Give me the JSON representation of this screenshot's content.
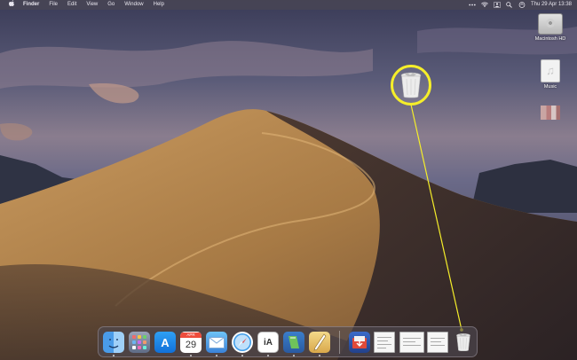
{
  "menubar": {
    "app_name": "Finder",
    "menus": [
      "File",
      "Edit",
      "View",
      "Go",
      "Window",
      "Help"
    ],
    "clock": "Thu 29 Apr  13:38"
  },
  "desktop": {
    "icons": [
      {
        "label": "Macintosh HD",
        "icon": "hard-drive-icon"
      },
      {
        "label": "Music",
        "icon": "music-file-icon"
      },
      {
        "label": "",
        "icon": "image-thumbnail-icon"
      }
    ]
  },
  "dock": {
    "calendar": {
      "month": "APR",
      "day": "29"
    },
    "ia_writer_text": "iA",
    "app_store_glyph": "A",
    "items": [
      "finder-icon",
      "launchpad-icon",
      "app-store-icon",
      "calendar-icon",
      "mail-icon",
      "safari-icon",
      "ia-writer-icon",
      "keynote-icon",
      "pages-icon",
      "downloads-folder-icon",
      "document-icon",
      "document-icon",
      "document-icon",
      "trash-icon"
    ]
  },
  "callout": {
    "target": "trash-icon",
    "color": "#f5ee2a"
  },
  "colors": {
    "callout": "#f5ee2a",
    "menubar": "#484654",
    "sky_top": "#3d3f5c",
    "dune": "#b58a55"
  }
}
